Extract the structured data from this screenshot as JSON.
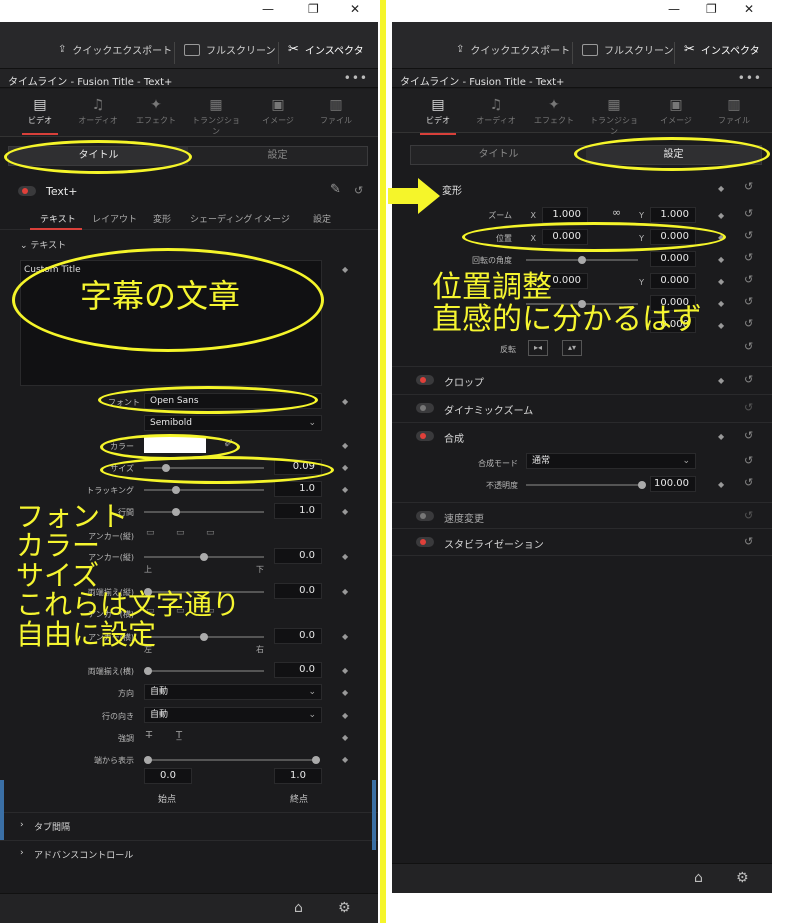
{
  "window": {
    "minimize": "—",
    "restore": "❐",
    "close": "✕"
  },
  "toolbar": {
    "quick_export": "クイックエクスポート",
    "fullscreen": "フルスクリーン",
    "inspector": "インスペクタ"
  },
  "header": {
    "title": "タイムライン - Fusion Title - Text+",
    "menu": "•••"
  },
  "tabs": [
    {
      "label": "ビデオ",
      "glyph": "▤"
    },
    {
      "label": "オーディオ",
      "glyph": "♫"
    },
    {
      "label": "エフェクト",
      "glyph": "✦"
    },
    {
      "label": "トランジション",
      "glyph": "▦"
    },
    {
      "label": "イメージ",
      "glyph": "▣"
    },
    {
      "label": "ファイル",
      "glyph": "▥"
    }
  ],
  "segments": {
    "title": "タイトル",
    "settings": "設定"
  },
  "left": {
    "node_title": "Text+",
    "subtabs": [
      "テキスト",
      "レイアウト",
      "変形",
      "シェーディング",
      "イメージ",
      "設定"
    ],
    "text_section": "テキスト",
    "text_content": "Custom Title",
    "font_label": "フォント",
    "font_value": "Open Sans",
    "style_value": "Semibold",
    "color_label": "カラー",
    "size_label": "サイズ",
    "size_value": "0.09",
    "tracking_label": "トラッキング",
    "tracking_value": "1.0",
    "linespacing_label": "行間",
    "linespacing_value": "1.0",
    "anchor_v_label": "アンカー(縦)",
    "anchor_v2_label": "アンカー(縦)",
    "anchor_v2_value": "0.0",
    "top_label": "上",
    "bottom_label": "下",
    "justify_v_label": "両端揃え(縦)",
    "justify_v_value": "0.0",
    "anchor_h_label": "アンカー(横)",
    "anchor_h2_label": "アンカー(横)",
    "anchor_h2_value": "0.0",
    "left_label": "左",
    "right_label": "右",
    "justify_h_label": "両端揃え(横)",
    "justify_h_value": "0.0",
    "direction_label": "方向",
    "direction_value": "自動",
    "line_dir_label": "行の向き",
    "line_dir_value": "自動",
    "emphasis_label": "強調",
    "write_on_label": "端から表示",
    "start_value": "0.0",
    "end_value": "1.0",
    "start_label": "始点",
    "end_label": "終点",
    "tab_spacing": "タブ間隔",
    "advanced": "アドバンスコントロール"
  },
  "right": {
    "transform_section": "変形",
    "zoom_label": "ズーム",
    "zoom_x": "1.000",
    "zoom_y": "1.000",
    "position_label": "位置",
    "pos_x": "0.000",
    "pos_y": "0.000",
    "rotation_label": "回転の角度",
    "rotation_value": "0.000",
    "anchor_x": "0.000",
    "anchor_y": "0.000",
    "pitch_value": "0.000",
    "yaw_value": "0.000",
    "flip_label": "反転",
    "x_label": "X",
    "y_label": "Y",
    "crop": "クロップ",
    "dynamic_zoom": "ダイナミックズーム",
    "composite": "合成",
    "composite_mode_label": "合成モード",
    "composite_mode_value": "通常",
    "opacity_label": "不透明度",
    "opacity_value": "100.00",
    "speed_change": "速度変更",
    "stabilization": "スタビライゼーション"
  },
  "annotations": {
    "subtitle_text": "字幕の文章",
    "font_notes": [
      "フォント",
      "カラー",
      "サイズ",
      "これらは文字通り",
      "自由に設定"
    ],
    "position_notes": [
      "位置調整",
      "直感的に分かるはず"
    ]
  },
  "colors": {
    "accent": "#d9403a",
    "annotation": "#f5f52a",
    "panel": "#1b1b1d"
  }
}
